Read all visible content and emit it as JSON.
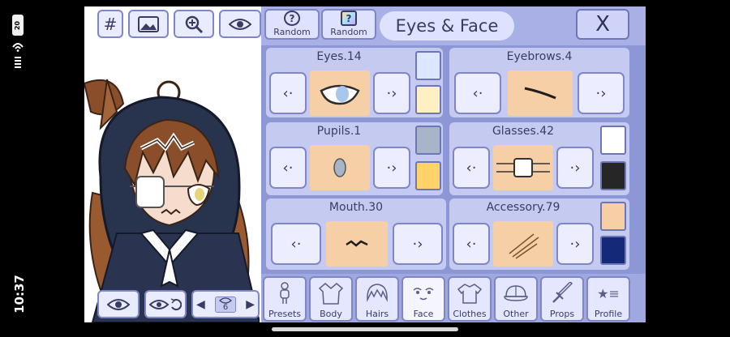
{
  "status": {
    "time": "10:37",
    "battery": "20"
  },
  "toolbar": {
    "grid_label": "#",
    "random_pose_label": "Random",
    "random_color_label": "Random",
    "close_label": "X"
  },
  "title": "Eyes & Face",
  "parts": [
    {
      "name": "Eyes.14",
      "swatches": [
        "#dce8ff",
        "#fff0c4"
      ]
    },
    {
      "name": "Eyebrows.4"
    },
    {
      "name": "Pupils.1",
      "swatches": [
        "#a8b4c8",
        "#ffd36a"
      ]
    },
    {
      "name": "Glasses.42",
      "swatches": [
        "#ffffff",
        "#262626"
      ]
    },
    {
      "name": "Mouth.30"
    },
    {
      "name": "Accessory.79",
      "swatches": [
        "#f6cfa6",
        "#142a78"
      ]
    }
  ],
  "bottom_tools": {
    "page_number": "6"
  },
  "categories": [
    {
      "label": "Presets",
      "icon": "figure-icon"
    },
    {
      "label": "Body",
      "icon": "jacket-icon"
    },
    {
      "label": "Hairs",
      "icon": "hair-icon"
    },
    {
      "label": "Face",
      "icon": "face-icon",
      "active": true
    },
    {
      "label": "Clothes",
      "icon": "shirt-icon"
    },
    {
      "label": "Other",
      "icon": "cap-icon"
    },
    {
      "label": "Props",
      "icon": "sword-icon"
    },
    {
      "label": "Profile",
      "icon": "star-list-icon"
    }
  ]
}
